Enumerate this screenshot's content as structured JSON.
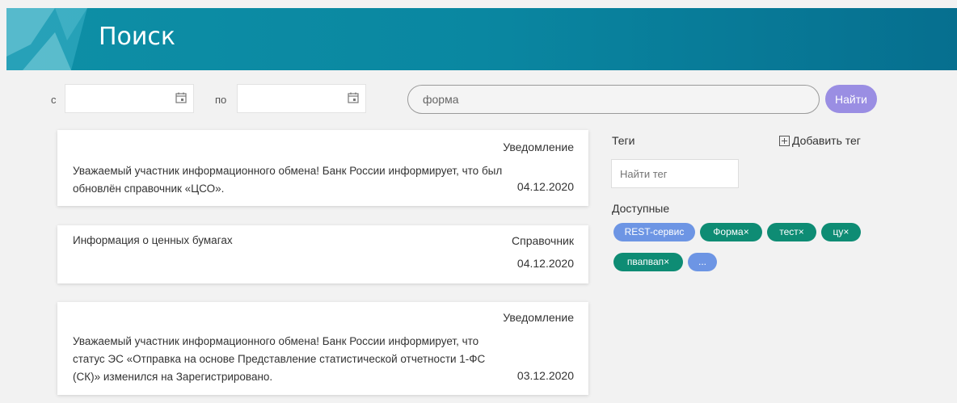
{
  "header": {
    "title": "Поиск"
  },
  "filters": {
    "from_label": "с",
    "from_value": "",
    "to_label": "по",
    "to_value": "",
    "search_value": "форма",
    "search_button": "Найти"
  },
  "results": [
    {
      "type": "Уведомление",
      "text": "Уважаемый участник информационного обмена! Банк России информирует, что был обновлён справочник «ЦСО».",
      "date": "04.12.2020"
    },
    {
      "type": "Справочник",
      "text": "Информация о ценных бумагах",
      "date": "04.12.2020"
    },
    {
      "type": "Уведомление",
      "text": "Уважаемый участник информационного обмена! Банк России информирует, что статус ЭС «Отправка на основе Представление статистической отчетности 1-ФС (СК)» изменился на Зарегистрировано.",
      "date": "03.12.2020"
    }
  ],
  "tags": {
    "title": "Теги",
    "add_label": "Добавить тег",
    "search_placeholder": "Найти тег",
    "available_label": "Доступные",
    "items": [
      {
        "label": "REST-сервис",
        "color": "#6d95e4"
      },
      {
        "label": "Форма×",
        "color": "#0e8c74"
      },
      {
        "label": "тест×",
        "color": "#0e8c74"
      },
      {
        "label": "цу×",
        "color": "#0e8c74"
      },
      {
        "label": "пвапвап×",
        "color": "#0e8c74"
      },
      {
        "label": "...",
        "color": "#6d95e4"
      }
    ]
  },
  "icons": {
    "calendar": "calendar-icon",
    "add": "plus-square-icon"
  }
}
